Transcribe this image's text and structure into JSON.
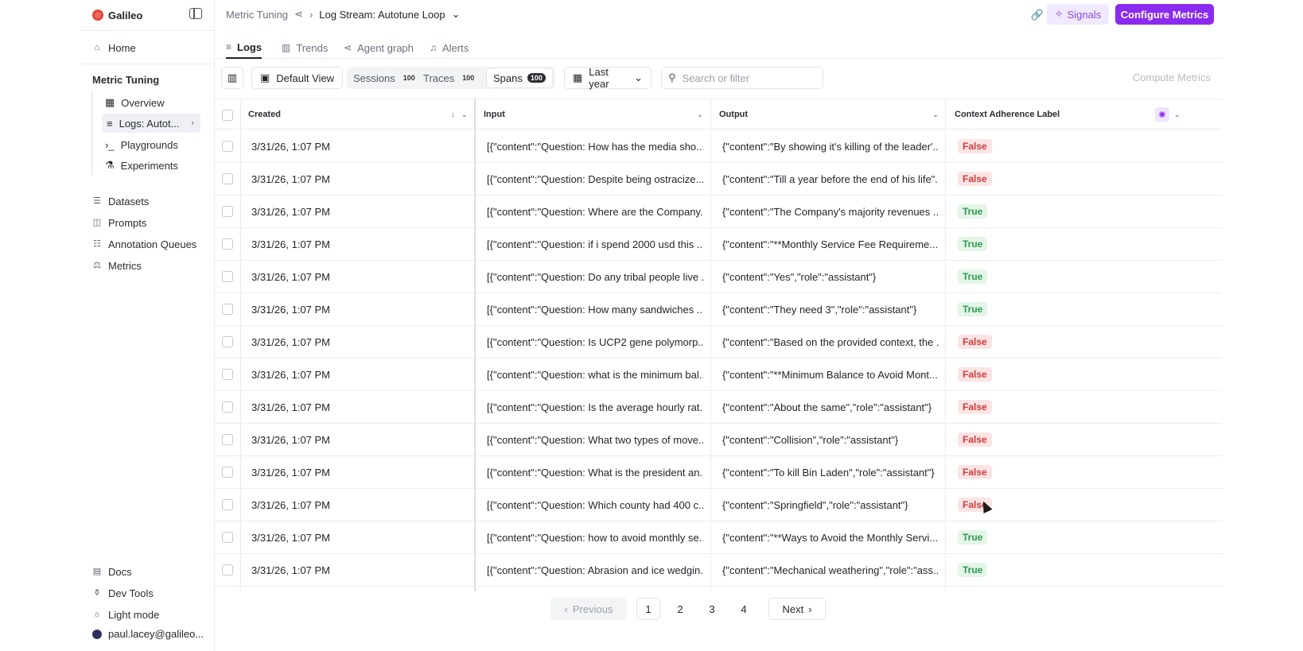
{
  "app": {
    "name": "Galileo"
  },
  "sidebar": {
    "home": "Home",
    "group_title": "Metric Tuning",
    "sub_items": [
      "Overview",
      "Logs: Autot...",
      "Playgrounds",
      "Experiments"
    ],
    "items": [
      "Datasets",
      "Prompts",
      "Annotation Queues",
      "Metrics"
    ],
    "bottom": [
      "Docs",
      "Dev Tools",
      "Light mode"
    ],
    "user": "paul.lacey@galileo..."
  },
  "header": {
    "crumb_project": "Metric Tuning",
    "crumb_current": "Log Stream: Autotune Loop",
    "signals": "Signals",
    "configure": "Configure Metrics"
  },
  "tabs": [
    "Logs",
    "Trends",
    "Agent graph",
    "Alerts"
  ],
  "toolbar": {
    "default_view": "Default View",
    "sessions": "Sessions",
    "sessions_count": "100",
    "traces": "Traces",
    "traces_count": "100",
    "spans": "Spans",
    "spans_count": "100",
    "date_range": "Last year",
    "search_placeholder": "Search or filter",
    "compute": "Compute Metrics"
  },
  "table": {
    "columns": [
      "Created",
      "Input",
      "Output",
      "Context Adherence Label"
    ],
    "rows": [
      {
        "created": "3/31/26, 1:07 PM",
        "input": "[{\"content\":\"Question: How has the media sho...",
        "output": "{\"content\":\"By showing it's killing of the leader'...",
        "label": "False"
      },
      {
        "created": "3/31/26, 1:07 PM",
        "input": "[{\"content\":\"Question: Despite being ostracize...",
        "output": "{\"content\":\"Till a year before the end of his life\"...",
        "label": "False"
      },
      {
        "created": "3/31/26, 1:07 PM",
        "input": "[{\"content\":\"Question: Where are the Company...",
        "output": "{\"content\":\"The Company's majority revenues ...",
        "label": "True"
      },
      {
        "created": "3/31/26, 1:07 PM",
        "input": "[{\"content\":\"Question: if i spend 2000 usd this ...",
        "output": "{\"content\":\"**Monthly Service Fee Requireme...",
        "label": "True"
      },
      {
        "created": "3/31/26, 1:07 PM",
        "input": "[{\"content\":\"Question: Do any tribal people live ...",
        "output": "{\"content\":\"Yes\",\"role\":\"assistant\"}",
        "label": "True"
      },
      {
        "created": "3/31/26, 1:07 PM",
        "input": "[{\"content\":\"Question: How many sandwiches ...",
        "output": "{\"content\":\"They need 3\",\"role\":\"assistant\"}",
        "label": "True"
      },
      {
        "created": "3/31/26, 1:07 PM",
        "input": "[{\"content\":\"Question: Is UCP2 gene polymorp...",
        "output": "{\"content\":\"Based on the provided context, the ...",
        "label": "False"
      },
      {
        "created": "3/31/26, 1:07 PM",
        "input": "[{\"content\":\"Question: what is the minimum bal...",
        "output": "{\"content\":\"**Minimum Balance to Avoid Mont...",
        "label": "False"
      },
      {
        "created": "3/31/26, 1:07 PM",
        "input": "[{\"content\":\"Question: Is the average hourly rat...",
        "output": "{\"content\":\"About the same\",\"role\":\"assistant\"}",
        "label": "False"
      },
      {
        "created": "3/31/26, 1:07 PM",
        "input": "[{\"content\":\"Question: What two types of move...",
        "output": "{\"content\":\"Collision\",\"role\":\"assistant\"}",
        "label": "False"
      },
      {
        "created": "3/31/26, 1:07 PM",
        "input": "[{\"content\":\"Question: What is the president an...",
        "output": "{\"content\":\"To kill Bin Laden\",\"role\":\"assistant\"}",
        "label": "False"
      },
      {
        "created": "3/31/26, 1:07 PM",
        "input": "[{\"content\":\"Question: Which county had 400 c...",
        "output": "{\"content\":\"Springfield\",\"role\":\"assistant\"}",
        "label": "False"
      },
      {
        "created": "3/31/26, 1:07 PM",
        "input": "[{\"content\":\"Question: how to avoid monthly se...",
        "output": "{\"content\":\"**Ways to Avoid the Monthly Servi...",
        "label": "True"
      },
      {
        "created": "3/31/26, 1:07 PM",
        "input": "[{\"content\":\"Question: Abrasion and ice wedgin...",
        "output": "{\"content\":\"Mechanical weathering\",\"role\":\"ass...",
        "label": "True"
      }
    ]
  },
  "pagination": {
    "previous": "Previous",
    "pages": [
      "1",
      "2",
      "3",
      "4"
    ],
    "next": "Next"
  },
  "colors": {
    "accent": "#8b2bf0",
    "false_text": "#d33b3b",
    "false_bg": "#fde4e4",
    "true_text": "#2e9a4e",
    "true_bg": "#e3f6e8"
  }
}
